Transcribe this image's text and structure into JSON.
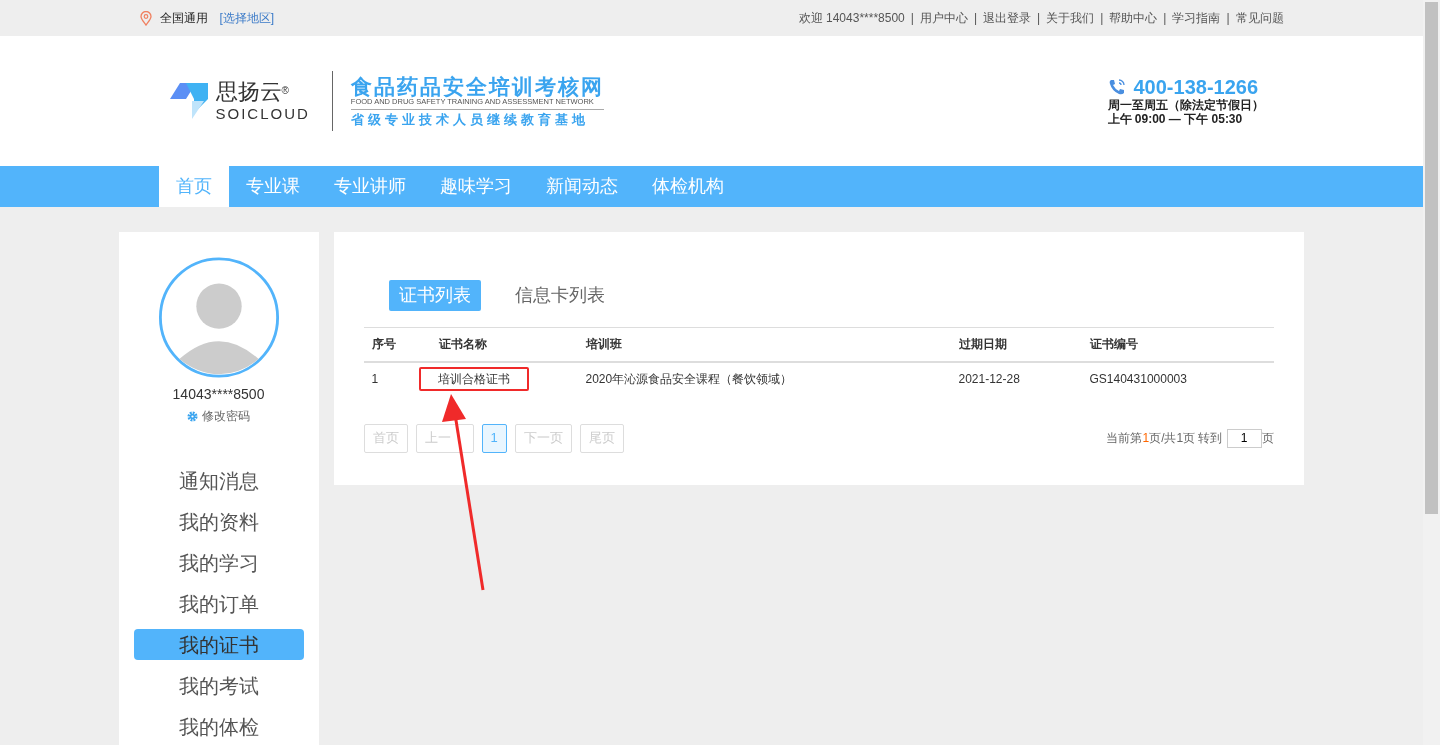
{
  "topbar": {
    "region": "全国通用",
    "region_link": "[选择地区]",
    "separator": "|",
    "links": [
      "欢迎 14043****8500",
      "用户中心",
      "退出登录",
      "关于我们",
      "帮助中心",
      "学习指南",
      "常见问题"
    ]
  },
  "header": {
    "brand_cn": "思扬云",
    "brand_mark": "®",
    "brand_en": "SOICLOUD",
    "site_title": "食品药品安全培训考核网",
    "site_subtitle_en": "FOOD AND DRUG SAFETY TRAINING AND ASSESSMENT NETWORK",
    "site_slogan": "省级专业技术人员继续教育基地",
    "phone": "400-138-1266",
    "hours_days": "周一至周五（除法定节假日）",
    "hours_time": "上午 09:00 — 下午 05:30"
  },
  "nav": [
    {
      "label": "首页",
      "selected": true
    },
    {
      "label": "专业课",
      "selected": false
    },
    {
      "label": "专业讲师",
      "selected": false
    },
    {
      "label": "趣味学习",
      "selected": false
    },
    {
      "label": "新闻动态",
      "selected": false
    },
    {
      "label": "体检机构",
      "selected": false
    }
  ],
  "profile": {
    "username": "14043****8500",
    "change_password": "修改密码"
  },
  "sidebar": {
    "items": [
      {
        "label": "通知消息",
        "selected": false
      },
      {
        "label": "我的资料",
        "selected": false
      },
      {
        "label": "我的学习",
        "selected": false
      },
      {
        "label": "我的订单",
        "selected": false
      },
      {
        "label": "我的证书",
        "selected": true
      },
      {
        "label": "我的考试",
        "selected": false
      },
      {
        "label": "我的体检",
        "selected": false
      }
    ]
  },
  "tabs": [
    {
      "label": "证书列表",
      "selected": true
    },
    {
      "label": "信息卡列表",
      "selected": false
    }
  ],
  "table": {
    "columns": [
      "序号",
      "证书名称",
      "培训班",
      "过期日期",
      "证书编号"
    ],
    "rows": [
      [
        "1",
        "培训合格证书",
        "2020年沁源食品安全课程（餐饮领域）",
        "2021-12-28",
        "GS140431000003"
      ]
    ]
  },
  "pagination": {
    "buttons": [
      {
        "label": "首页",
        "selected": false
      },
      {
        "label": "上一",
        "selected": false
      },
      {
        "label": "1",
        "selected": true
      },
      {
        "label": "下一页",
        "selected": false
      },
      {
        "label": "尾页",
        "selected": false
      }
    ],
    "info_before": "当前第",
    "info_current": "1",
    "info_after": "页/共1页 转到",
    "goto_value": "1",
    "goto_suffix": "页"
  }
}
